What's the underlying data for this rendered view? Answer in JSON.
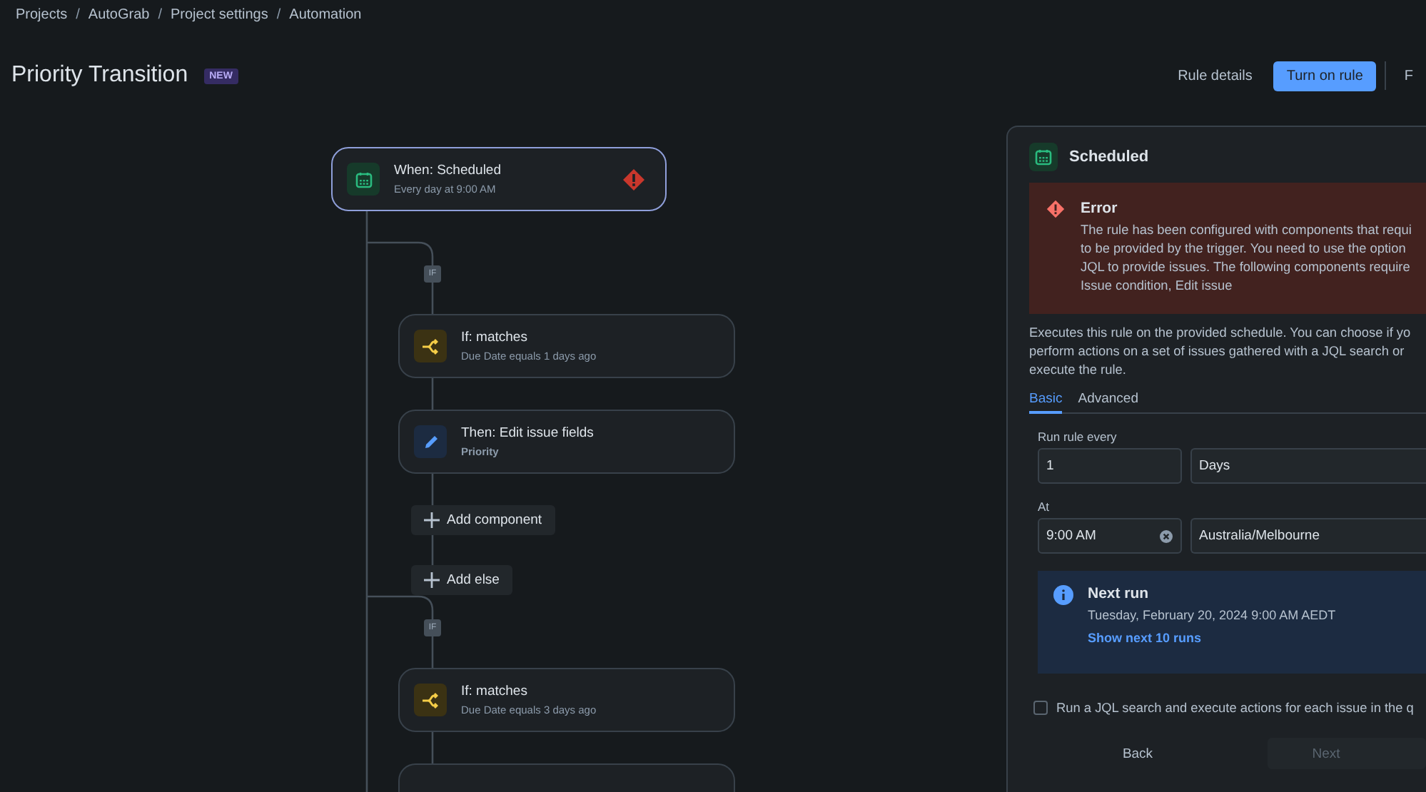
{
  "breadcrumbs": [
    "Projects",
    "AutoGrab",
    "Project settings",
    "Automation"
  ],
  "breadcrumb_separator": "/",
  "title": "Priority Transition",
  "title_badge": "NEW",
  "header_buttons": [
    {
      "label": "Rule details",
      "kind": "subtle"
    },
    {
      "label": "Turn on rule",
      "kind": "primary"
    },
    {
      "label": "F",
      "kind": "subtle"
    }
  ],
  "flow": {
    "trigger": {
      "title": "When: Scheduled",
      "subtitle": "Every day at 9:00 AM",
      "selected": true,
      "error": true
    },
    "branches": [
      {
        "badge": "IF",
        "steps": [
          {
            "kind": "condition",
            "title": "If: matches",
            "subtitle": "Due Date equals 1 days ago"
          },
          {
            "kind": "action",
            "title": "Then: Edit issue fields",
            "subtitle": "Priority"
          }
        ],
        "add_buttons": [
          "Add component",
          "Add else"
        ]
      },
      {
        "badge": "IF",
        "steps": [
          {
            "kind": "condition",
            "title": "If: matches",
            "subtitle": "Due Date equals 3 days ago"
          }
        ]
      }
    ]
  },
  "panel": {
    "title": "Scheduled",
    "error": {
      "title": "Error",
      "lines": [
        "The rule has been configured with components that requi",
        "to be provided by the trigger. You need to use the option",
        "JQL to provide issues. The following components require",
        "Issue condition, Edit issue"
      ]
    },
    "description_lines": [
      "Executes this rule on the provided schedule. You can choose if yo",
      "perform actions on a set of issues gathered with a JQL search or",
      "execute the rule."
    ],
    "tabs": [
      {
        "label": "Basic",
        "selected": true
      },
      {
        "label": "Advanced",
        "selected": false
      }
    ],
    "run_every": {
      "label": "Run rule every",
      "value": "1",
      "unit": "Days"
    },
    "at": {
      "label": "At",
      "value": "9:00 AM",
      "timezone": "Australia/Melbourne"
    },
    "next_run": {
      "title": "Next run",
      "date": "Tuesday, February 20, 2024 9:00 AM AEDT",
      "link": "Show next 10 runs"
    },
    "jql_checkbox": {
      "label": "Run a JQL search and execute actions for each issue in the q",
      "checked": false
    },
    "buttons": [
      {
        "label": "Back",
        "disabled": false
      },
      {
        "label": "Next",
        "disabled": true
      }
    ]
  }
}
